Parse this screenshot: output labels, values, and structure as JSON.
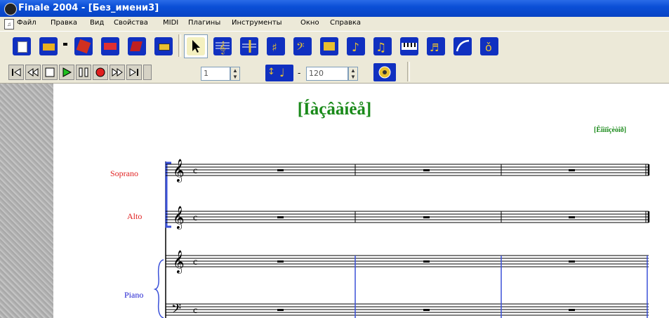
{
  "window": {
    "title": "Finale 2004 - [Без_имени3]"
  },
  "menu": {
    "doc_icon": "document-icon",
    "items": [
      "Файл",
      "Правка",
      "Вид",
      "Свойства",
      "MIDI",
      "Плагины",
      "Инструменты",
      "Окно",
      "Справка"
    ]
  },
  "playback": {
    "measure_value": "1",
    "tempo_separator": "-",
    "tempo_value": "120"
  },
  "score": {
    "title": "[Íàçâàíèå]",
    "composer": "[Êîìïîçèòîð]",
    "staves": [
      {
        "label": "Soprano",
        "color": "#e02020"
      },
      {
        "label": "Alto",
        "color": "#e02020"
      },
      {
        "label": "Piano",
        "color": "#2020d0"
      }
    ]
  },
  "colors": {
    "title_green": "#1a8a1a",
    "bracket_blue": "#3a50d8"
  }
}
